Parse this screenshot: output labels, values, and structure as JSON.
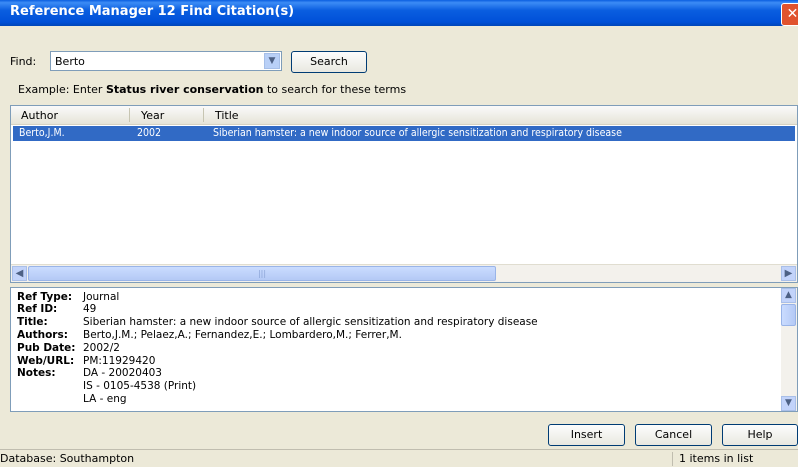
{
  "window": {
    "title": "Reference Manager 12 Find Citation(s)",
    "close_glyph": "✕"
  },
  "find": {
    "label": "Find:",
    "value": "Berto",
    "search_label": "Search",
    "example_prefix": "Example: Enter ",
    "example_terms": "Status river conservation",
    "example_suffix": " to search for these terms"
  },
  "list": {
    "columns": [
      "Author",
      "Year",
      "Title"
    ],
    "rows": [
      {
        "author": "Berto,J.M.",
        "year": "2002",
        "title": "Siberian hamster: a new indoor source of allergic sensitization and respiratory disease",
        "selected": true
      }
    ]
  },
  "detail": {
    "ref_type_label": "Ref Type:",
    "ref_type": "Journal",
    "ref_id_label": "Ref ID:",
    "ref_id": "49",
    "title_label": "Title:",
    "title": "Siberian hamster: a new indoor source of allergic sensitization and respiratory disease",
    "authors_label": "Authors:",
    "authors": "Berto,J.M.; Pelaez,A.; Fernandez,E.; Lombardero,M.; Ferrer,M.",
    "pub_date_label": "Pub Date:",
    "pub_date": "2002/2",
    "web_url_label": "Web/URL:",
    "web_url": "PM:11929420",
    "notes_label": "Notes:",
    "notes": [
      "DA - 20020403",
      "IS - 0105-4538 (Print)",
      "LA - eng"
    ]
  },
  "buttons": {
    "insert": "Insert",
    "cancel": "Cancel",
    "help": "Help"
  },
  "status": {
    "database": "Database: Southampton",
    "count": "1 items in list"
  },
  "colors": {
    "title_bar": "#0a5ee0",
    "selection": "#316ac5",
    "window_bg": "#ece9d8"
  }
}
